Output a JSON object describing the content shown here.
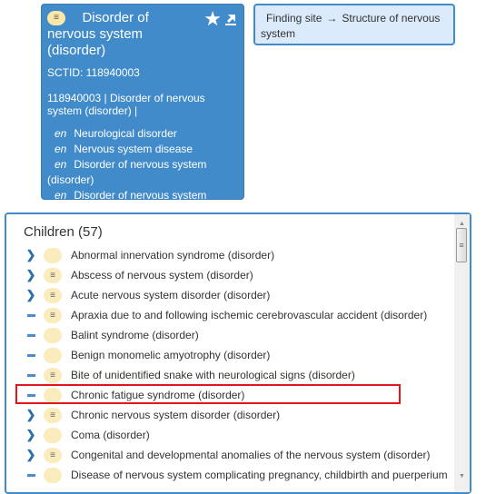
{
  "concept": {
    "title_line1": "Disorder of",
    "title_line2": "nervous system",
    "title_line3": "(disorder)",
    "definition_badge": "≡",
    "sctid_label": "SCTID: 118940003",
    "fsn_line1": "118940003 | Disorder of nervous",
    "fsn_line2": "system (disorder) |",
    "descriptions": [
      {
        "lang": "en",
        "term": "Neurological disorder"
      },
      {
        "lang": "en",
        "term": "Nervous system disease"
      },
      {
        "lang": "en",
        "term": "Disorder of nervous system"
      },
      {
        "lang": "",
        "term": "(disorder)"
      },
      {
        "lang": "en",
        "term": "Disorder of nervous system"
      }
    ],
    "actions": {
      "favorite_icon": "star-icon",
      "export_icon": "external-link-icon"
    }
  },
  "attribute": {
    "name": "Finding site",
    "arrow": "→",
    "value_line1": "Structure of nervous",
    "value_line2": "system"
  },
  "children": {
    "title": "Children (57)",
    "items": [
      {
        "toggle": "expand",
        "defined": false,
        "label": "Abnormal innervation syndrome (disorder)"
      },
      {
        "toggle": "expand",
        "defined": true,
        "label": "Abscess of nervous system (disorder)"
      },
      {
        "toggle": "expand",
        "defined": true,
        "label": "Acute nervous system disorder (disorder)"
      },
      {
        "toggle": "leaf",
        "defined": true,
        "label": "Apraxia due to and following ischemic cerebrovascular accident (disorder)"
      },
      {
        "toggle": "leaf",
        "defined": false,
        "label": "Balint syndrome (disorder)"
      },
      {
        "toggle": "leaf",
        "defined": false,
        "label": "Benign monomelic amyotrophy (disorder)"
      },
      {
        "toggle": "leaf",
        "defined": true,
        "label": "Bite of unidentified snake with neurological signs (disorder)"
      },
      {
        "toggle": "leaf",
        "defined": false,
        "label": "Chronic fatigue syndrome (disorder)",
        "highlighted": true
      },
      {
        "toggle": "expand",
        "defined": true,
        "label": "Chronic nervous system disorder (disorder)"
      },
      {
        "toggle": "expand",
        "defined": false,
        "label": "Coma (disorder)"
      },
      {
        "toggle": "expand",
        "defined": true,
        "label": "Congenital and developmental anomalies of the nervous system (disorder)"
      },
      {
        "toggle": "leaf",
        "defined": false,
        "label": "Disease of nervous system complicating pregnancy, childbirth and puerperium"
      }
    ]
  },
  "glyphs": {
    "expand": "❯",
    "defined_badge": "≡",
    "star": "★",
    "scroll_up": "▲",
    "scroll_down": "▼",
    "thumb_grip": "≡"
  },
  "colors": {
    "card_blue": "#428bca",
    "attr_bg": "#dbeafa",
    "badge_bg": "#fbecbd",
    "highlight_red": "#e4141e"
  }
}
